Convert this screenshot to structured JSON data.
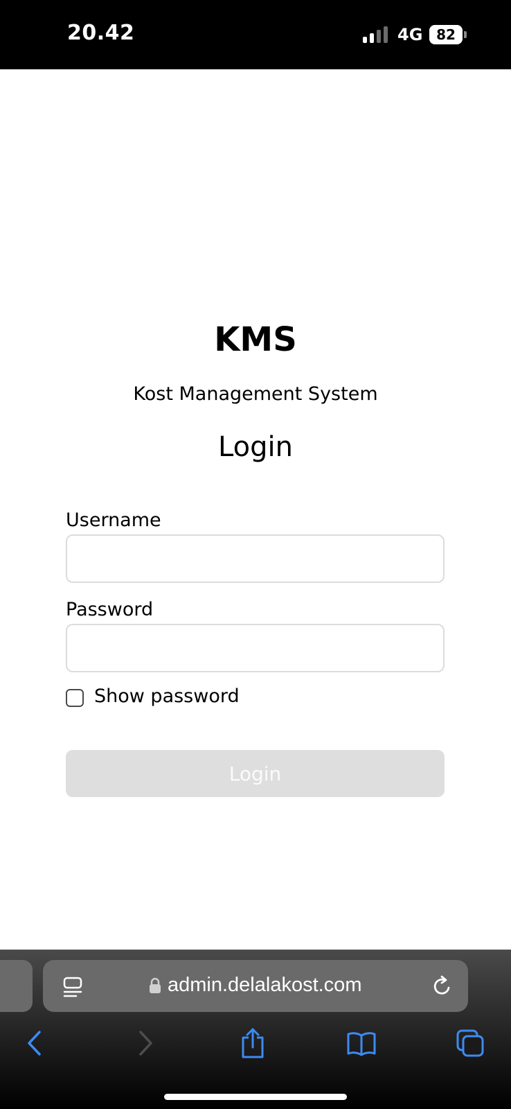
{
  "status_bar": {
    "time": "20.42",
    "network": "4G",
    "battery": "82",
    "signal_bars_active": 2,
    "signal_bars_total": 4
  },
  "app": {
    "title": "KMS",
    "subtitle": "Kost Management System",
    "heading": "Login"
  },
  "form": {
    "username_label": "Username",
    "username_value": "",
    "password_label": "Password",
    "password_value": "",
    "show_password_label": "Show password",
    "show_password_checked": false,
    "submit_label": "Login"
  },
  "browser": {
    "url": "admin.delalakost.com",
    "icons": [
      "reader-icon",
      "lock-icon",
      "reload-icon",
      "back-icon",
      "forward-icon",
      "share-icon",
      "bookmarks-icon",
      "tabs-icon"
    ],
    "accent_color": "#3d8bf2"
  }
}
